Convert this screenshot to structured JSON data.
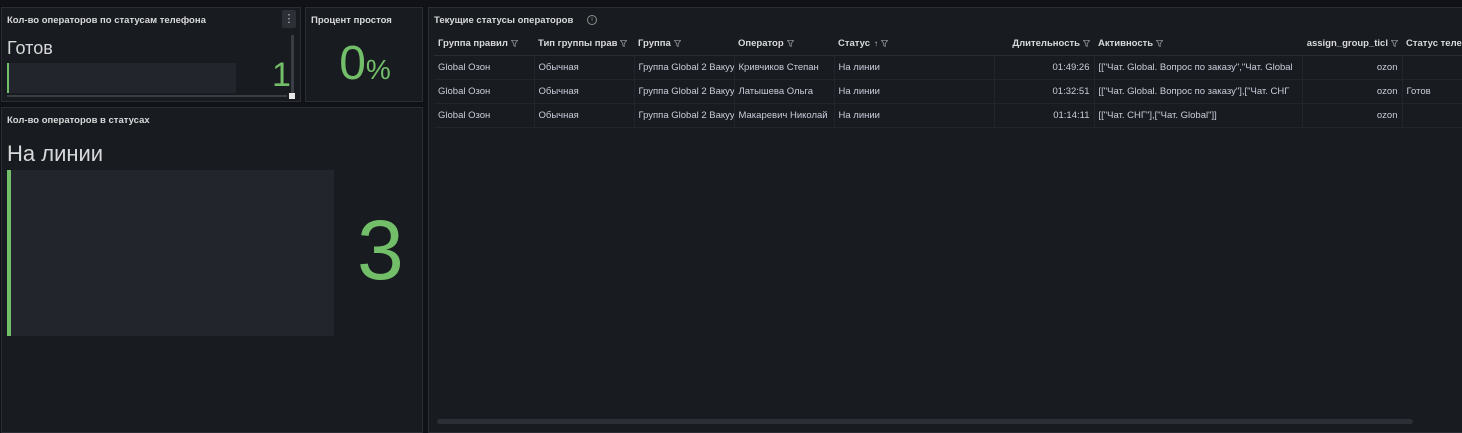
{
  "panel_phone_status": {
    "title": "Кол-во операторов по статусам телефона",
    "stat_name": "Готов",
    "stat_value": "1",
    "menu_icon": "vertical-ellipsis-icon"
  },
  "panel_idle": {
    "title": "Процент простоя",
    "value": "0",
    "unit": "%"
  },
  "panel_status_count": {
    "title": "Кол-во операторов в статусах",
    "stat_name": "На линии",
    "stat_value": "3"
  },
  "panel_current_statuses": {
    "title": "Текущие статусы операторов",
    "info_icon": "info-circle-icon",
    "columns": [
      "Группа правил",
      "Тип группы прав",
      "Группа",
      "Оператор",
      "Статус",
      "Длительность",
      "Активность",
      "assign_group_ticl",
      "Статус теле"
    ],
    "rows": [
      [
        "Global Озон",
        "Обычная",
        "Группа Global 2 Вакуу",
        "Кривчиков Степан",
        "На линии",
        "01:49:26",
        "[[\"Чат. Global. Вопрос по заказу\",\"Чат. Global",
        "ozon",
        ""
      ],
      [
        "Global Озон",
        "Обычная",
        "Группа Global 2 Вакуу",
        "Латышева Ольга",
        "На линии",
        "01:32:51",
        "[[\"Чат. Global. Вопрос по заказу\"],[\"Чат. СНГ",
        "ozon",
        "Готов"
      ],
      [
        "Global Озон",
        "Обычная",
        "Группа Global 2 Вакуу",
        "Макаревич Николай",
        "На линии",
        "01:14:11",
        "[[\"Чат. СНГ\"],[\"Чат. Global\"]]",
        "ozon",
        ""
      ]
    ]
  },
  "colors": {
    "background": "#111217",
    "panel": "#181b1f",
    "accent_green": "#73bf69"
  }
}
